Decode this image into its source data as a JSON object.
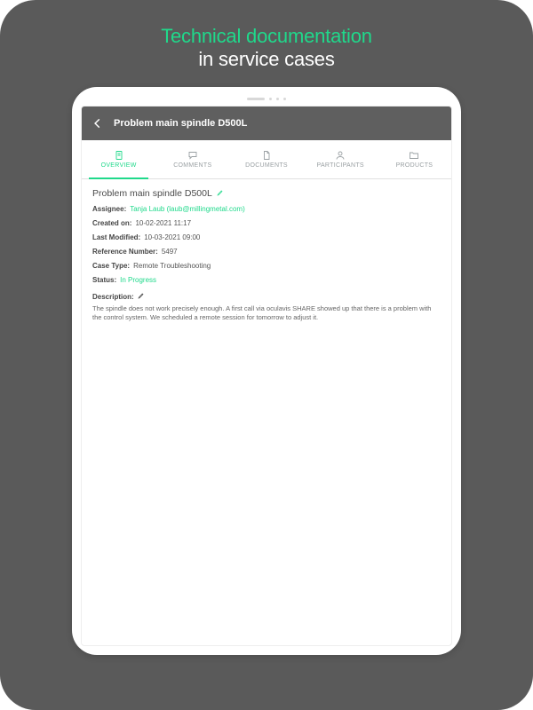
{
  "marketing": {
    "line1": "Technical documentation",
    "line2": "in service cases"
  },
  "appbar": {
    "title": "Problem main spindle D500L"
  },
  "tabs": [
    {
      "label": "OVERVIEW",
      "icon": "doc-icon",
      "active": true
    },
    {
      "label": "COMMENTS",
      "icon": "chat-icon",
      "active": false
    },
    {
      "label": "DOCUMENTS",
      "icon": "file-icon",
      "active": false
    },
    {
      "label": "PARTICIPANTS",
      "icon": "user-icon",
      "active": false
    },
    {
      "label": "PRODUCTS",
      "icon": "folder-icon",
      "active": false
    }
  ],
  "case": {
    "title": "Problem main spindle D500L",
    "fields": {
      "assignee_label": "Assignee:",
      "assignee_value": "Tanja Laub (laub@millingmetal.com)",
      "created_label": "Created on:",
      "created_value": "10-02-2021 11:17",
      "modified_label": "Last Modified:",
      "modified_value": "10-03-2021 09:00",
      "ref_label": "Reference Number:",
      "ref_value": "5497",
      "type_label": "Case Type:",
      "type_value": "Remote Troubleshooting",
      "status_label": "Status:",
      "status_value": "In Progress"
    },
    "description_label": "Description:",
    "description": "The spindle does not work precisely enough. A first call via oculavis SHARE showed up that there is a problem with the control system. We scheduled a remote session for tomorrow to adjust it."
  }
}
